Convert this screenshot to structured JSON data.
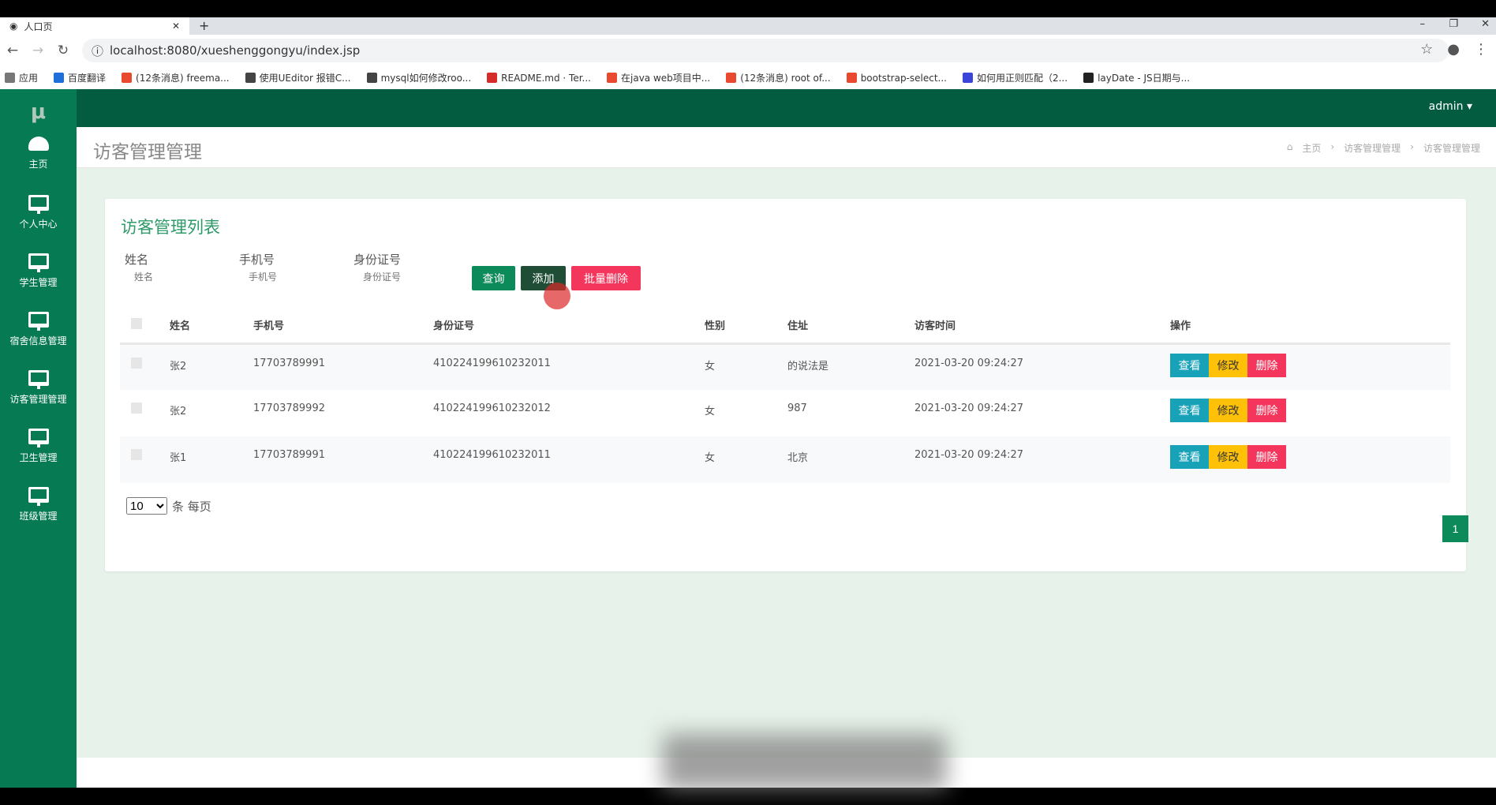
{
  "browser": {
    "tab_title": "人口页",
    "url": "localhost:8080/xueshenggongyu/index.jsp",
    "bookmarks": [
      "应用",
      "百度翻译",
      "(12条消息) freema...",
      "使用UEditor 报错C...",
      "mysql如何修改roo...",
      "README.md · Ter...",
      "在java web项目中...",
      "(12条消息) root of...",
      "bootstrap-select...",
      "如何用正则匹配（2...",
      "layDate - JS日期与..."
    ]
  },
  "header": {
    "logo": "μ",
    "user": "admin ▾"
  },
  "sidebar": {
    "items": [
      {
        "label": "主页",
        "icon": "dashboard-icon"
      },
      {
        "label": "个人中心",
        "icon": "monitor-icon"
      },
      {
        "label": "学生管理",
        "icon": "monitor-icon"
      },
      {
        "label": "宿舍信息管理",
        "icon": "monitor-icon"
      },
      {
        "label": "访客管理管理",
        "icon": "monitor-icon"
      },
      {
        "label": "卫生管理",
        "icon": "monitor-icon"
      },
      {
        "label": "班级管理",
        "icon": "monitor-icon"
      }
    ]
  },
  "page": {
    "title": "访客管理管理",
    "breadcrumb": [
      "主页",
      "访客管理管理",
      "访客管理管理"
    ]
  },
  "card": {
    "title": "访客管理列表",
    "filters": [
      {
        "label": "姓名",
        "placeholder": "姓名"
      },
      {
        "label": "手机号",
        "placeholder": "手机号"
      },
      {
        "label": "身份证号",
        "placeholder": "身份证号"
      }
    ],
    "buttons": {
      "query": "查询",
      "add": "添加",
      "batch_delete": "批量删除"
    },
    "columns": [
      "姓名",
      "手机号",
      "身份证号",
      "性别",
      "住址",
      "访客时间",
      "操作"
    ],
    "rows": [
      [
        "张2",
        "17703789991",
        "410224199610232011",
        "女",
        "的说法是",
        "2021-03-20 09:24:27"
      ],
      [
        "张2",
        "17703789992",
        "410224199610232012",
        "女",
        "987",
        "2021-03-20 09:24:27"
      ],
      [
        "张1",
        "17703789991",
        "410224199610232011",
        "女",
        "北京",
        "2021-03-20 09:24:27"
      ]
    ],
    "row_actions": {
      "view": "查看",
      "edit": "修改",
      "delete": "删除"
    },
    "page_size": "10",
    "page_size_suffix": "条 每页",
    "current_page": "1"
  },
  "colors": {
    "header": "#035c3f",
    "sidebar": "#067a52",
    "view": "#17a2b8",
    "edit": "#ffc107",
    "delete": "#f5365c",
    "query": "#0d8a5a",
    "add": "#1f4d36"
  }
}
